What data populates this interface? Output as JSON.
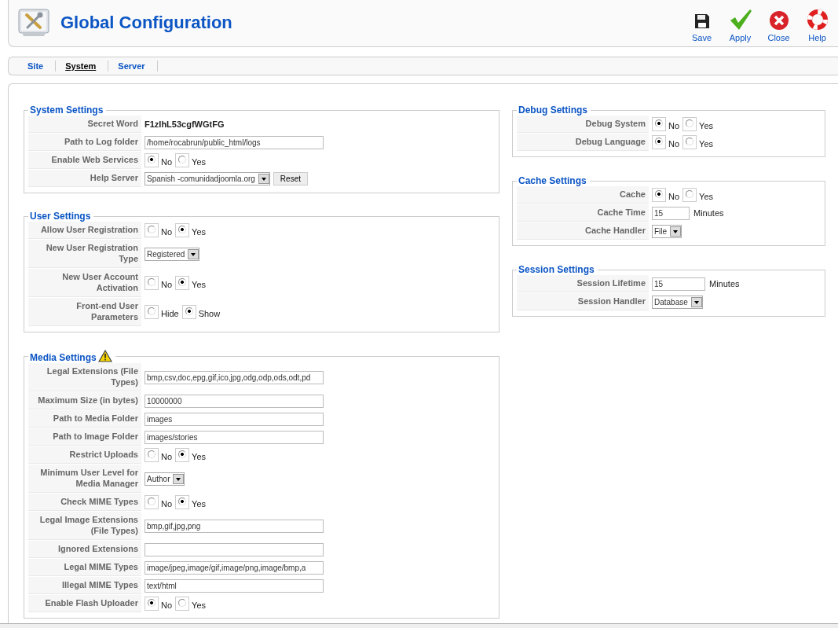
{
  "header": {
    "title": "Global Configuration",
    "toolbar": [
      {
        "kind": "save",
        "label": "Save"
      },
      {
        "kind": "apply",
        "label": "Apply"
      },
      {
        "kind": "close",
        "label": "Close"
      },
      {
        "kind": "help",
        "label": "Help"
      }
    ]
  },
  "tabs": [
    {
      "label": "Site",
      "selected": false
    },
    {
      "label": "System",
      "selected": true
    },
    {
      "label": "Server",
      "selected": false
    }
  ],
  "columns": [
    [
      {
        "title": "System Settings",
        "fields": [
          {
            "label": "Secret Word",
            "kind": "static",
            "value": "F1zIhL53cgfWGtFG"
          },
          {
            "label": "Path to Log folder",
            "kind": "input",
            "value": "/home/rocabrun/public_html/logs"
          },
          {
            "label": "Enable Web Services",
            "kind": "radio",
            "options": [
              {
                "label": "No",
                "selected": true
              },
              {
                "label": "Yes",
                "selected": false
              }
            ]
          },
          {
            "label": "Help Server",
            "kind": "select",
            "value": "Spanish -comunidadjoomla.org",
            "button": "Reset"
          }
        ]
      },
      {
        "title": "User Settings",
        "fields": [
          {
            "label": "Allow User Registration",
            "kind": "radio",
            "options": [
              {
                "label": "No",
                "selected": false
              },
              {
                "label": "Yes",
                "selected": true
              }
            ]
          },
          {
            "label": "New User Registration Type",
            "kind": "select",
            "value": "Registered"
          },
          {
            "label": "New User Account Activation",
            "kind": "radio",
            "options": [
              {
                "label": "No",
                "selected": false
              },
              {
                "label": "Yes",
                "selected": true
              }
            ]
          },
          {
            "label": "Front-end User Parameters",
            "kind": "radio",
            "options": [
              {
                "label": "Hide",
                "selected": false
              },
              {
                "label": "Show",
                "selected": true
              }
            ]
          }
        ]
      },
      {
        "title": "Media Settings",
        "warning": true,
        "fields": [
          {
            "label": "Legal Extensions (File Types)",
            "kind": "input",
            "value": "bmp,csv,doc,epg,gif,ico,jpg,odg,odp,ods,odt,pd"
          },
          {
            "label": "Maximum Size (in bytes)",
            "kind": "input",
            "value": "10000000"
          },
          {
            "label": "Path to Media Folder",
            "kind": "input",
            "value": "images"
          },
          {
            "label": "Path to Image Folder",
            "kind": "input",
            "value": "images/stories"
          },
          {
            "label": "Restrict Uploads",
            "kind": "radio",
            "options": [
              {
                "label": "No",
                "selected": false
              },
              {
                "label": "Yes",
                "selected": true
              }
            ]
          },
          {
            "label": "Minimum User Level for Media Manager",
            "kind": "select",
            "value": "Author"
          },
          {
            "label": "Check MIME Types",
            "kind": "radio",
            "options": [
              {
                "label": "No",
                "selected": false
              },
              {
                "label": "Yes",
                "selected": true
              }
            ]
          },
          {
            "label": "Legal Image Extensions (File Types)",
            "kind": "input",
            "value": "bmp,gif,jpg,png"
          },
          {
            "label": "Ignored Extensions",
            "kind": "input"
          },
          {
            "label": "Legal MIME Types",
            "kind": "input",
            "value": "image/jpeg,image/gif,image/png,image/bmp,a"
          },
          {
            "label": "Illegal MIME Types",
            "kind": "input",
            "value": "text/html"
          },
          {
            "label": "Enable Flash Uploader",
            "kind": "radio",
            "options": [
              {
                "label": "No",
                "selected": true
              },
              {
                "label": "Yes",
                "selected": false
              }
            ]
          }
        ]
      }
    ],
    [
      {
        "title": "Debug Settings",
        "fields": [
          {
            "label": "Debug System",
            "kind": "radio",
            "options": [
              {
                "label": "No",
                "selected": true
              },
              {
                "label": "Yes",
                "selected": false
              }
            ]
          },
          {
            "label": "Debug Language",
            "kind": "radio",
            "options": [
              {
                "label": "No",
                "selected": true
              },
              {
                "label": "Yes",
                "selected": false
              }
            ]
          }
        ]
      },
      {
        "title": "Cache Settings",
        "fields": [
          {
            "label": "Cache",
            "kind": "radio",
            "options": [
              {
                "label": "No",
                "selected": true
              },
              {
                "label": "Yes",
                "selected": false
              }
            ]
          },
          {
            "label": "Cache Time",
            "kind": "input",
            "value": "15",
            "suffix": "Minutes"
          },
          {
            "label": "Cache Handler",
            "kind": "select",
            "value": "File"
          }
        ]
      },
      {
        "title": "Session Settings",
        "fields": [
          {
            "label": "Session Lifetime",
            "kind": "input",
            "value": "15",
            "suffix": "Minutes"
          },
          {
            "label": "Session Handler",
            "kind": "select",
            "value": "Database"
          }
        ]
      }
    ]
  ]
}
